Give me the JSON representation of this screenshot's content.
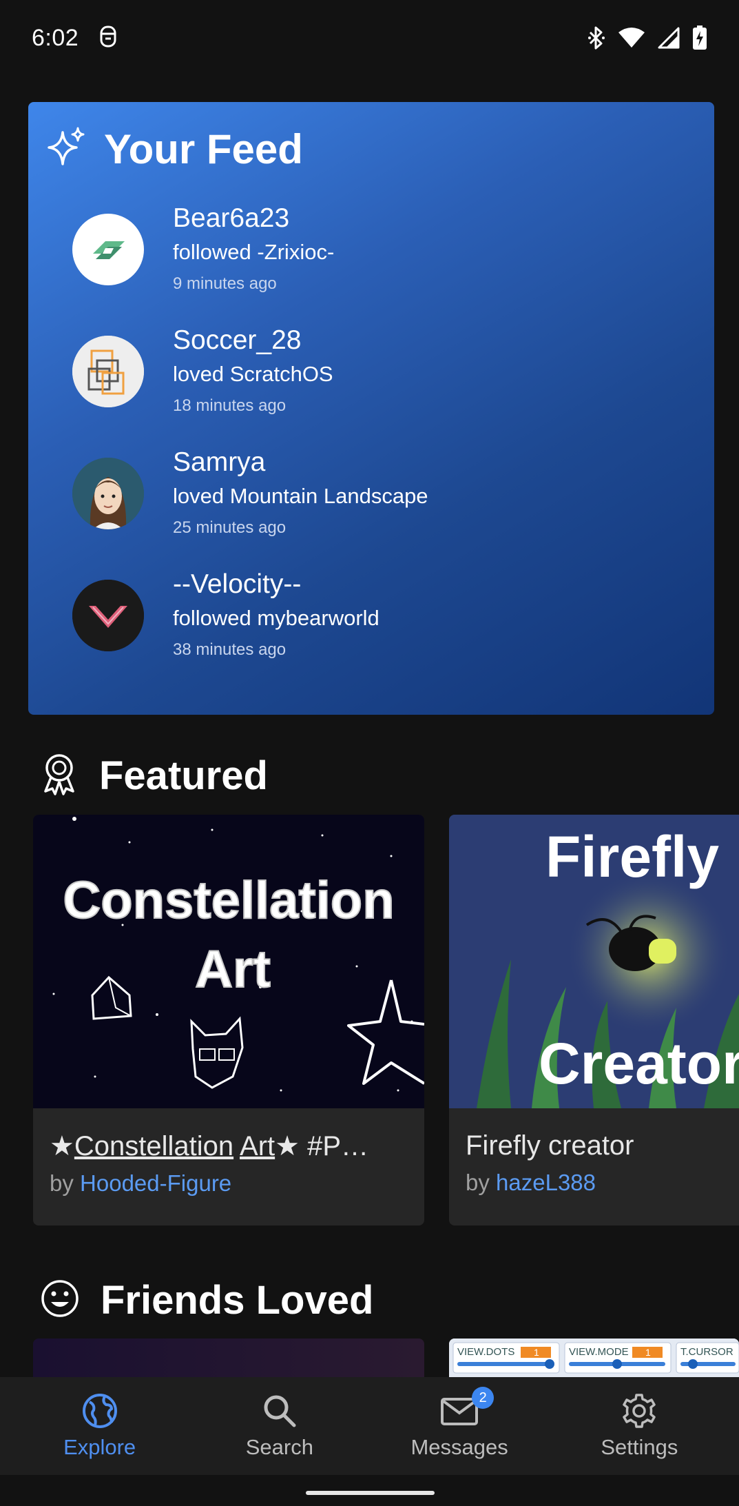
{
  "status_bar": {
    "time": "6:02"
  },
  "feed": {
    "title": "Your Feed",
    "items": [
      {
        "user": "Bear6a23",
        "action": "followed -Zrixioc-",
        "time": "9 minutes ago",
        "avatar": "green-arrow-avatar"
      },
      {
        "user": "Soccer_28",
        "action": "loved ScratchOS",
        "time": "18 minutes ago",
        "avatar": "squares-logo-avatar"
      },
      {
        "user": "Samrya",
        "action": "loved Mountain Landscape",
        "time": "25 minutes ago",
        "avatar": "girl-portrait-avatar"
      },
      {
        "user": "--Velocity--",
        "action": "followed mybearworld",
        "time": "38 minutes ago",
        "avatar": "v-logo-avatar"
      }
    ]
  },
  "featured": {
    "title": "Featured",
    "projects": [
      {
        "title_prefix": "★",
        "title_word1": "Constellation",
        "title_word2": "Art",
        "title_suffix": "★ #P…",
        "by": "by",
        "author": "Hooded-Figure",
        "thumb_text1": "Constellation",
        "thumb_text2": "Art"
      },
      {
        "title": "Firefly creator",
        "by": "by",
        "author": "hazeL388",
        "thumb_text1": "Firefly",
        "thumb_text2": "Creator"
      }
    ]
  },
  "friends_loved": {
    "title": "Friends Loved",
    "partial_labels": [
      "VIEW.DOTS",
      "VIEW.MODE",
      "T.CURSOR"
    ],
    "partial_values": [
      "1",
      "1"
    ]
  },
  "nav": {
    "items": [
      {
        "label": "Explore",
        "icon": "globe-icon",
        "active": true
      },
      {
        "label": "Search",
        "icon": "search-icon",
        "active": false
      },
      {
        "label": "Messages",
        "icon": "mail-icon",
        "active": false,
        "badge": "2"
      },
      {
        "label": "Settings",
        "icon": "gear-icon",
        "active": false
      }
    ]
  },
  "colors": {
    "accent": "#4f8ff0",
    "link": "#5b9bf2",
    "background": "#121212",
    "card": "#262626"
  }
}
